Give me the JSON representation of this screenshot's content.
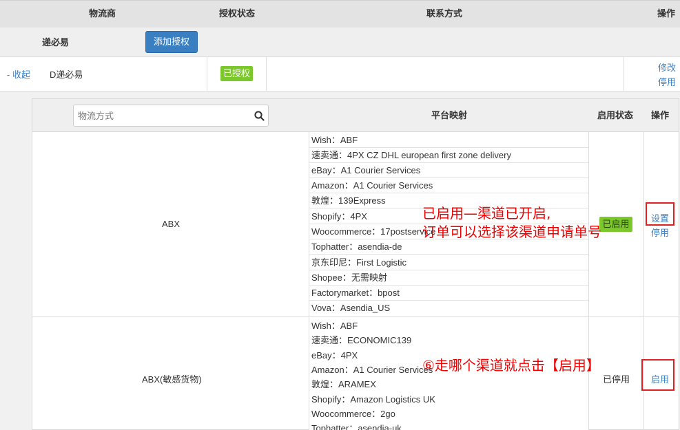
{
  "header": {
    "col_carrier": "物流商",
    "col_auth_status": "授权状态",
    "col_contact": "联系方式",
    "col_actions": "操作"
  },
  "carrier_row": {
    "name": "递必易",
    "add_auth_label": "添加授权"
  },
  "account_row": {
    "collapse_label": "- 收起",
    "account_name": "D递必易",
    "auth_badge": "已授权",
    "edit_label": "修改",
    "disable_label": "停用"
  },
  "channel_table": {
    "search_placeholder": "物流方式",
    "col_platform_mapping": "平台映射",
    "col_status": "启用状态",
    "col_actions": "操作",
    "channels": [
      {
        "name": "ABX",
        "status": "已启用",
        "action_primary": "设置",
        "action_secondary": "停用",
        "mappings": [
          "Wish：ABF",
          "速卖通：4PX CZ DHL european first zone delivery",
          "eBay：A1 Courier Services",
          "Amazon：A1 Courier Services",
          "敦煌：139Express",
          "Shopify：4PX",
          "Woocommerce：17postservice",
          "Tophatter：asendia-de",
          "京东印尼：First Logistic",
          "Shopee：无需映射",
          "Factorymarket：bpost",
          "Vova：Asendia_US"
        ]
      },
      {
        "name": "ABX(敏感货物)",
        "status": "已停用",
        "action_primary": "启用",
        "mappings": [
          "Wish：ABF",
          "速卖通：ECONOMIC139",
          "eBay：4PX",
          "Amazon：A1 Courier Services",
          "敦煌：ARAMEX",
          "Shopify：Amazon Logistics UK",
          "Woocommerce：2go",
          "Tophatter：asendia-uk"
        ]
      }
    ]
  },
  "annotations": {
    "note1_line1": "已启用—渠道已开启,",
    "note1_line2": "订单可以选择该渠道申请单号",
    "note2": "⑥走哪个渠道就点击【启用】"
  },
  "colors": {
    "accent_blue": "#3a7fc1",
    "badge_green": "#7cc72b",
    "annotation_red": "#e00000"
  }
}
